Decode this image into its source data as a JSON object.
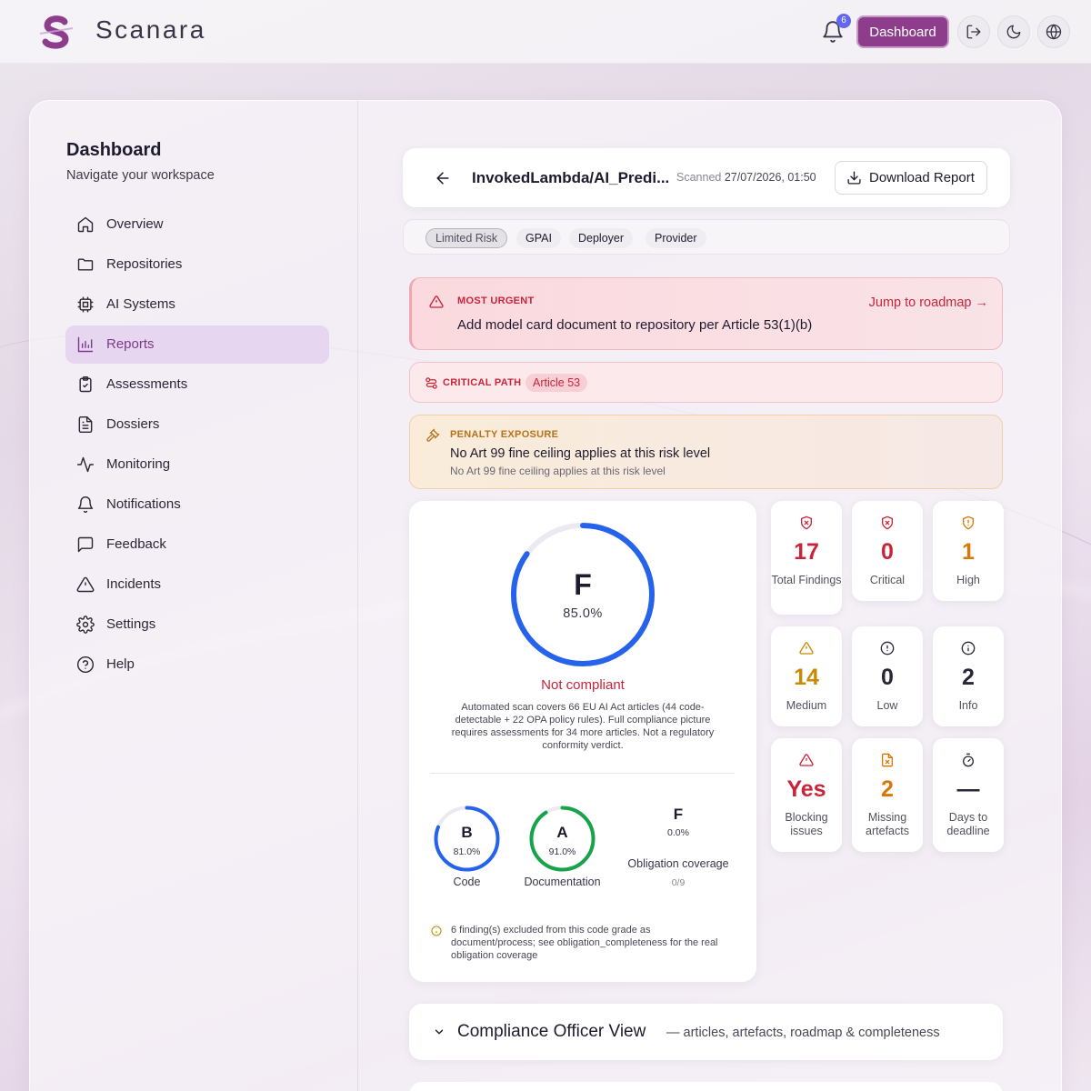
{
  "app": {
    "name": "Scanara"
  },
  "header": {
    "notification_count": "6",
    "dashboard_label": "Dashboard"
  },
  "sidebar": {
    "title": "Dashboard",
    "subtitle": "Navigate your workspace",
    "items": [
      {
        "label": "Overview",
        "icon": "home-icon"
      },
      {
        "label": "Repositories",
        "icon": "folder-icon"
      },
      {
        "label": "AI Systems",
        "icon": "chip-icon"
      },
      {
        "label": "Reports",
        "icon": "bar-chart-icon",
        "active": true
      },
      {
        "label": "Assessments",
        "icon": "clipboard-check-icon"
      },
      {
        "label": "Dossiers",
        "icon": "document-icon"
      },
      {
        "label": "Monitoring",
        "icon": "activity-icon"
      },
      {
        "label": "Notifications",
        "icon": "bell-icon"
      },
      {
        "label": "Feedback",
        "icon": "message-icon"
      },
      {
        "label": "Incidents",
        "icon": "warning-icon"
      },
      {
        "label": "Settings",
        "icon": "gear-icon"
      },
      {
        "label": "Help",
        "icon": "help-icon"
      }
    ]
  },
  "report": {
    "title": "InvokedLambda/AI_Predi...",
    "scanned_label": "Scanned",
    "scanned_date": "27/07/2026, 01:50",
    "download_label": "Download Report",
    "tags": [
      "Limited Risk",
      "GPAI",
      "Deployer",
      "Provider"
    ]
  },
  "alerts": {
    "urgent_label": "MOST URGENT",
    "urgent_text": "Add model card document to repository per Article 53(1)(b)",
    "urgent_link": "Jump to roadmap →",
    "critical_label": "CRITICAL PATH",
    "critical_tag": "Article 53",
    "penalty_label": "PENALTY EXPOSURE",
    "penalty_text": "No Art 99 fine ceiling applies at this risk level",
    "penalty_sub": "No Art 99 fine ceiling applies at this risk level"
  },
  "score": {
    "grade": "F",
    "percent": "85.0%",
    "percent_value": 85.0,
    "status": "Not compliant",
    "note": "Automated scan covers 66 EU AI Act articles (44 code-detectable + 22 OPA policy rules). Full compliance picture requires assessments for 34 more articles. Not a regulatory conformity verdict.",
    "sub": [
      {
        "grade": "B",
        "percent": "81.0%",
        "value": 81.0,
        "label": "Code",
        "color": "#2563eb"
      },
      {
        "grade": "A",
        "percent": "91.0%",
        "value": 91.0,
        "label": "Documentation",
        "color": "#16a34a"
      }
    ],
    "obligation": {
      "grade": "F",
      "percent": "0.0%",
      "label": "Obligation coverage",
      "count": "0/9"
    },
    "excluded_note": "6 finding(s) excluded from this code grade as document/process; see obligation_completeness for the real obligation coverage",
    "ring_color": "#2563eb"
  },
  "stats": [
    {
      "value": "17",
      "label": "Total Findings",
      "color": "#c8243a",
      "icon": "shield-x-icon"
    },
    {
      "value": "0",
      "label": "Critical",
      "color": "#c8243a",
      "icon": "shield-x-icon"
    },
    {
      "value": "1",
      "label": "High",
      "color": "#d97706",
      "icon": "shield-alert-icon"
    },
    {
      "value": "14",
      "label": "Medium",
      "color": "#ca8a04",
      "icon": "warning-icon"
    },
    {
      "value": "0",
      "label": "Low",
      "color": "#2a2636",
      "icon": "alert-circle-icon"
    },
    {
      "value": "2",
      "label": "Info",
      "color": "#2a2636",
      "icon": "info-icon"
    },
    {
      "value": "Yes",
      "label": "Blocking issues",
      "color": "#c8243a",
      "icon": "warning-icon"
    },
    {
      "value": "2",
      "label": "Missing artefacts",
      "color": "#d97706",
      "icon": "file-x-icon"
    },
    {
      "value": "—",
      "label": "Days to deadline",
      "color": "#2a2636",
      "icon": "timer-icon"
    }
  ],
  "officer": {
    "title": "Compliance Officer View",
    "subtitle": "— articles, artefacts, roadmap & completeness"
  }
}
